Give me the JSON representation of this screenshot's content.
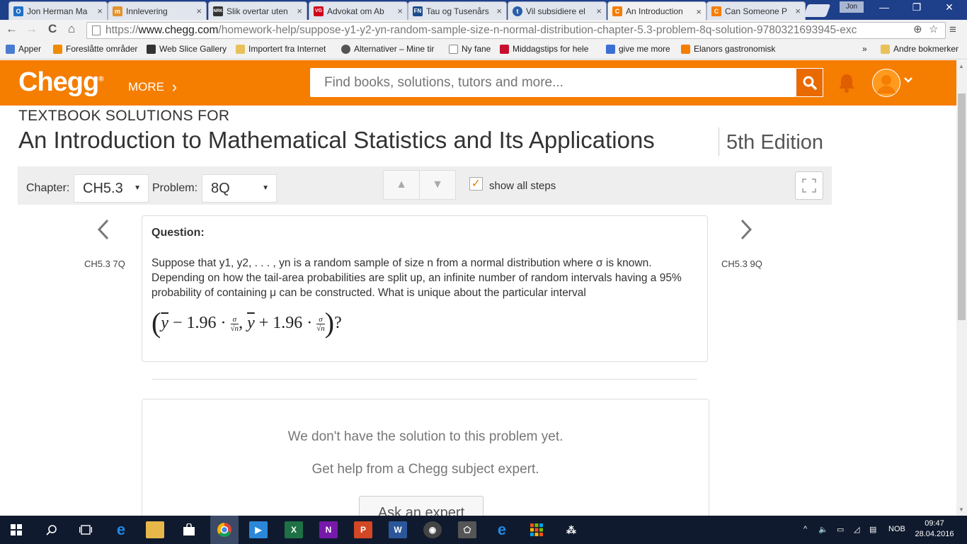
{
  "browser": {
    "tabs": [
      {
        "label": "Jon Herman Ma",
        "fav_text": "O",
        "fav_color": "#1f6fc5"
      },
      {
        "label": "Innlevering",
        "fav_text": "m",
        "fav_color": "#e2922e"
      },
      {
        "label": "Slik overtar uten",
        "fav_text": "NRK",
        "fav_color": "#333333"
      },
      {
        "label": "Advokat om Ab",
        "fav_text": "VG",
        "fav_color": "#d0021b"
      },
      {
        "label": "Tau og Tusenårs",
        "fav_text": "FN",
        "fav_color": "#1a4d8f"
      },
      {
        "label": "Vil subsidiere el",
        "fav_text": "t",
        "fav_color": "#2a5ea8"
      },
      {
        "label": "An Introduction",
        "fav_text": "C",
        "fav_color": "#f57d00"
      },
      {
        "label": "Can Someone P",
        "fav_text": "C",
        "fav_color": "#f57d00"
      }
    ],
    "close_glyph": "×",
    "user": "Jon",
    "window_controls": [
      "—",
      "❐",
      "✕"
    ],
    "url_scheme": "https://",
    "url_host": "www.chegg.com",
    "url_path": "/homework-help/suppose-y1-y2-yn-random-sample-size-n-normal-distribution-chapter-5.3-problem-8q-solution-9780321693945-exc",
    "nav": {
      "back": "←",
      "forward": "→",
      "reload": "C",
      "home": "⌂",
      "zoom": "⊕",
      "star": "☆",
      "menu": "≡"
    },
    "bookmarks": [
      {
        "label": "Apper",
        "color": "#4a7bd1"
      },
      {
        "label": "Foreslåtte områder",
        "color": "#f08a00"
      },
      {
        "label": "Web Slice Gallery",
        "color": "#333333"
      },
      {
        "label": "Importert fra Internet",
        "color": "#e8c15a"
      },
      {
        "label": "Alternativer – Mine tir",
        "color": "#555555"
      },
      {
        "label": "Ny fane",
        "color": "#ffffff"
      },
      {
        "label": "Middagstips for hele",
        "color": "#c8102e"
      },
      {
        "label": "give me more",
        "color": "#3b6fd4"
      },
      {
        "label": "Elanors gastronomisk",
        "color": "#f57d00"
      }
    ],
    "bookmarks_overflow": "»",
    "other_bookmarks": "Andre bokmerker"
  },
  "header": {
    "logo": "Chegg",
    "logo_mark": "®",
    "more_label": "MORE",
    "more_chevron": "›",
    "search_placeholder": "Find books, solutions, tutors and more...",
    "search_icon": "search-icon",
    "bell_icon": "bell-icon",
    "avatar_icon": "user-avatar-icon",
    "accent_color": "#f57d00"
  },
  "book": {
    "kicker": "TEXTBOOK SOLUTIONS FOR",
    "title": "An Introduction to Mathematical Statistics and Its Applications",
    "edition": "5th Edition"
  },
  "controls": {
    "chapter_label": "Chapter:",
    "chapter_value": "CH5.3",
    "problem_label": "Problem:",
    "problem_value": "8Q",
    "select_arrow": "▼",
    "up_arrow": "▲",
    "down_arrow": "▼",
    "check_glyph": "✓",
    "show_all_steps": "show all steps",
    "show_all_steps_checked": true,
    "expand_glyph": "⤢"
  },
  "nav_problems": {
    "prev_chevron": "‹",
    "prev_label": "CH5.3 7Q",
    "next_chevron": "›",
    "next_label": "CH5.3 9Q"
  },
  "question": {
    "heading": "Question:",
    "text": "Suppose that y1, y2, . . . , yn is a random sample of size n from a normal distribution where σ is known. Depending on how the tail-area probabilities are split up, an infinite number of random intervals having a 95% probability of containing μ can be constructed. What is unique about the particular interval",
    "formula": {
      "open": "(",
      "ybar": "y",
      "minus": " − 1.96 · ",
      "sigma": "σ",
      "sqrtn": "√n",
      "comma": ", ",
      "plus": " + 1.96 · ",
      "close": ")",
      "qmark": "?"
    }
  },
  "answer": {
    "no_solution": "We don't have the solution to this problem yet.",
    "get_help": "Get help from a Chegg subject expert.",
    "ask_button": "Ask an expert"
  },
  "taskbar": {
    "clock_time": "09:47",
    "clock_date": "28.04.2016",
    "language": "NOB",
    "tray_chevron": "^"
  }
}
